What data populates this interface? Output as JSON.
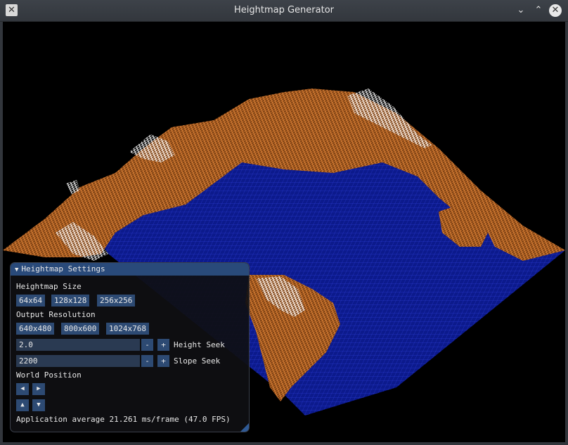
{
  "window": {
    "title": "Heightmap Generator"
  },
  "icons": {
    "app": "app-x-icon",
    "minimize": "chevron-down-icon",
    "maximize": "chevron-up-icon",
    "close": "close-icon"
  },
  "panel": {
    "title": "Heightmap Settings",
    "heightmap_size_label": "Heightmap Size",
    "size_buttons": [
      "64x64",
      "128x128",
      "256x256"
    ],
    "output_resolution_label": "Output Resolution",
    "resolution_buttons": [
      "640x480",
      "800x600",
      "1024x768"
    ],
    "height_seek": {
      "value": "2.0",
      "minus": "-",
      "plus": "+",
      "label": "Height Seek"
    },
    "slope_seek": {
      "value": "2200",
      "minus": "-",
      "plus": "+",
      "label": "Slope Seek"
    },
    "world_position_label": "World Position",
    "status": "Application average 21.261 ms/frame (47.0 FPS)"
  },
  "colors": {
    "water": "#0c1a8c",
    "land": "#d9782a",
    "snow": "#ffffff",
    "panel_header": "#294a7a"
  }
}
